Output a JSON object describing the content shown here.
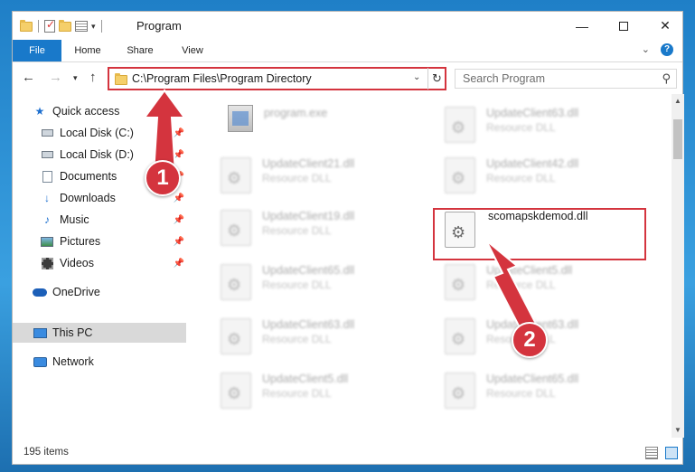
{
  "window": {
    "title": "Program",
    "controls": {
      "minimize": "—",
      "maximize": "",
      "close": "✕"
    }
  },
  "ribbon": {
    "tabs": [
      "File",
      "Home",
      "Share",
      "View"
    ],
    "expand_chevron": "⌄",
    "help": "?"
  },
  "navigation": {
    "back": "←",
    "forward": "→",
    "recent": "▾",
    "up": "↑",
    "address": "C:\\Program Files\\Program Directory",
    "address_dropdown": "⌄",
    "refresh": "↻",
    "search_placeholder": "Search Program",
    "search_icon": "⚲"
  },
  "sidebar": {
    "items": [
      {
        "label": "Quick access",
        "icon": "star-icon",
        "pinned": false
      },
      {
        "label": "Local Disk (C:)",
        "icon": "drive-icon",
        "pinned": true
      },
      {
        "label": "Local Disk (D:)",
        "icon": "drive-icon",
        "pinned": true
      },
      {
        "label": "Documents",
        "icon": "documents-icon",
        "pinned": true
      },
      {
        "label": "Downloads",
        "icon": "downloads-icon",
        "pinned": true
      },
      {
        "label": "Music",
        "icon": "music-icon",
        "pinned": true
      },
      {
        "label": "Pictures",
        "icon": "pictures-icon",
        "pinned": true
      },
      {
        "label": "Videos",
        "icon": "videos-icon",
        "pinned": true
      },
      {
        "label": "OneDrive",
        "icon": "onedrive-icon",
        "pinned": false
      },
      {
        "label": "This PC",
        "icon": "computer-icon",
        "pinned": false,
        "selected": true
      },
      {
        "label": "Network",
        "icon": "network-icon",
        "pinned": false
      }
    ]
  },
  "files": {
    "left": [
      {
        "name": "program.exe",
        "desc": ""
      },
      {
        "name": "UpdateClient21.dll",
        "desc": "Resource DLL"
      },
      {
        "name": "UpdateClient19.dll",
        "desc": "Resource DLL"
      },
      {
        "name": "UpdateClient65.dll",
        "desc": "Resource DLL"
      },
      {
        "name": "UpdateClient63.dll",
        "desc": "Resource DLL"
      },
      {
        "name": "UpdateClient5.dll",
        "desc": "Resource DLL"
      }
    ],
    "right": [
      {
        "name": "UpdateClient63.dll",
        "desc": "Resource DLL"
      },
      {
        "name": "UpdateClient42.dll",
        "desc": "Resource DLL"
      },
      {
        "name": "scomapskdemod.dll",
        "desc": ""
      },
      {
        "name": "UpdateClient5.dll",
        "desc": "Resource DLL"
      },
      {
        "name": "UpdateClient63.dll",
        "desc": "Resource DLL"
      },
      {
        "name": "UpdateClient65.dll",
        "desc": "Resource DLL"
      }
    ]
  },
  "status": {
    "item_count": "195 items"
  },
  "annotations": {
    "badge1": "1",
    "badge2": "2",
    "color": "#d4343e"
  }
}
